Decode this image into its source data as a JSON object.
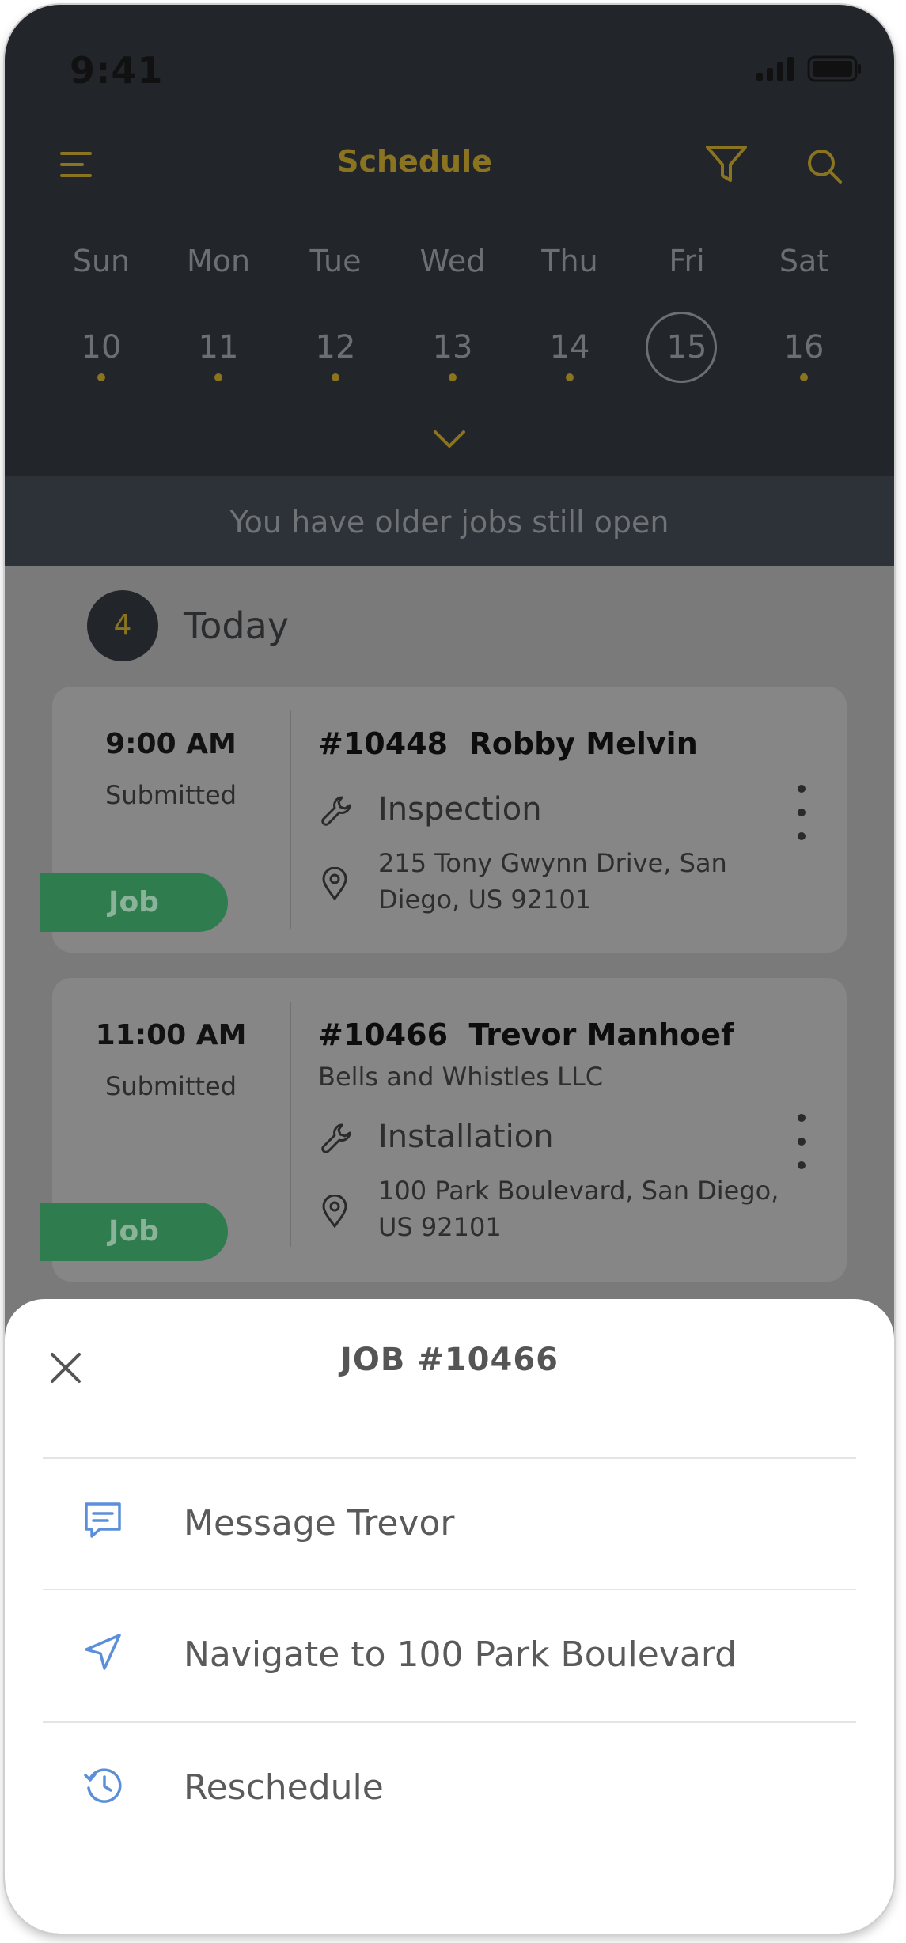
{
  "status_bar": {
    "time": "9:41"
  },
  "header": {
    "title": "Schedule",
    "menu_icon": "hamburger-icon",
    "filter_icon": "filter-icon",
    "search_icon": "search-icon"
  },
  "week": {
    "days": [
      {
        "name": "Sun",
        "date": "10"
      },
      {
        "name": "Mon",
        "date": "11"
      },
      {
        "name": "Tue",
        "date": "12"
      },
      {
        "name": "Wed",
        "date": "13"
      },
      {
        "name": "Thu",
        "date": "14"
      },
      {
        "name": "Fri",
        "date": "15"
      },
      {
        "name": "Sat",
        "date": "16"
      }
    ],
    "selected": "15"
  },
  "banner": {
    "text": "You have older jobs still open"
  },
  "today": {
    "count": "4",
    "label": "Today"
  },
  "jobs": [
    {
      "time": "9:00 AM",
      "status": "Submitted",
      "number": "#10448",
      "customer": "Robby Melvin",
      "company": "",
      "type": "Inspection",
      "address": "215 Tony Gwynn Drive, San Diego, US 92101",
      "tag": "Job"
    },
    {
      "time": "11:00 AM",
      "status": "Submitted",
      "number": "#10466",
      "customer": "Trevor Manhoef",
      "company": "Bells and Whistles LLC",
      "type": "Installation",
      "address": "100 Park Boulevard, San Diego, US 92101",
      "tag": "Job"
    }
  ],
  "sheet": {
    "title": "JOB #10466",
    "actions": [
      {
        "label": "Message Trevor",
        "icon": "message-icon"
      },
      {
        "label": "Navigate to 100 Park Boulevard",
        "icon": "navigate-icon"
      },
      {
        "label": "Reschedule",
        "icon": "reschedule-icon"
      }
    ]
  },
  "colors": {
    "accent": "#8a7420",
    "job_tag": "#2f7d4e",
    "sheet_icon": "#5b8fd9",
    "dark_bg": "#22262a"
  }
}
